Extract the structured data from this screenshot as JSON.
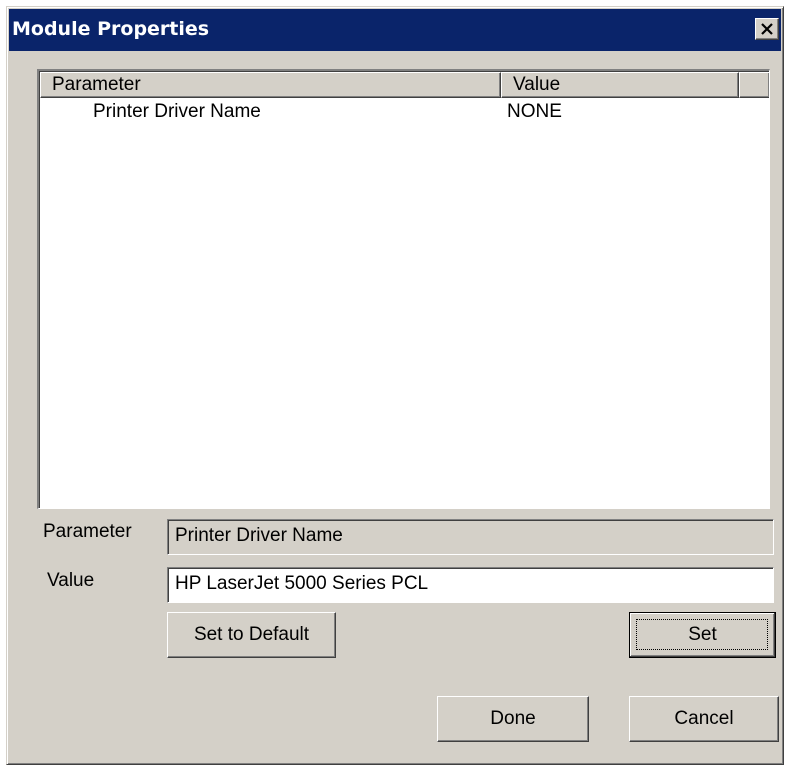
{
  "window": {
    "title": "Module Properties",
    "close_icon": "close-icon"
  },
  "list": {
    "columns": [
      "Parameter",
      "Value"
    ],
    "rows": [
      {
        "parameter": "Printer Driver Name",
        "value": "NONE"
      }
    ]
  },
  "editor": {
    "parameter_label": "Parameter",
    "parameter_value": "Printer Driver Name",
    "value_label": "Value",
    "value_value": "HP LaserJet 5000 Series PCL"
  },
  "buttons": {
    "set_to_default": "Set to Default",
    "set": "Set",
    "done": "Done",
    "cancel": "Cancel"
  },
  "colors": {
    "dialog_face": "#d4d0c8",
    "titlebar": "#0a246a"
  }
}
